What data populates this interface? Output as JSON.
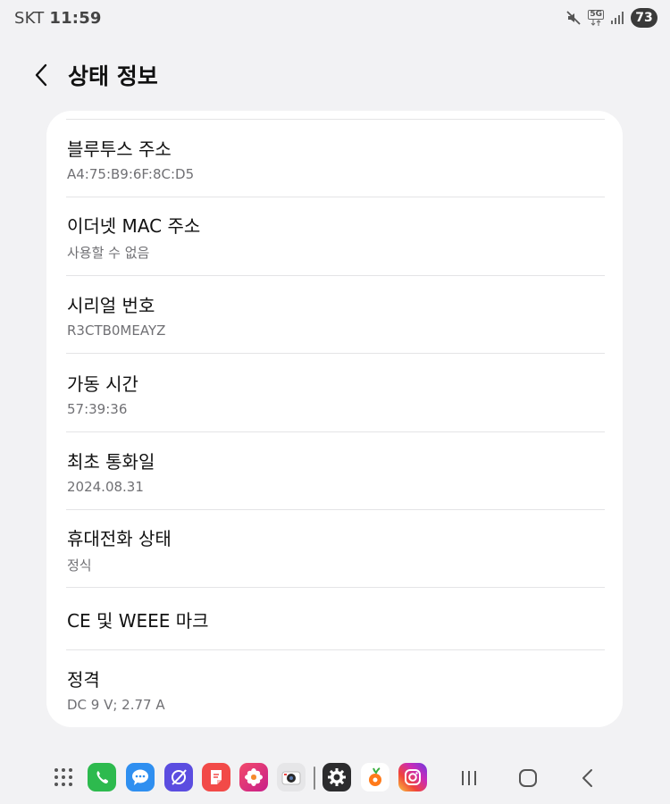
{
  "status_bar": {
    "carrier": "SKT",
    "time": "11:59",
    "network": "5G",
    "battery": "73",
    "icons": [
      "mute-icon",
      "network-5g-icon",
      "signal-icon"
    ]
  },
  "header": {
    "title": "상태 정보",
    "back_icon": "chevron-left-icon"
  },
  "items": [
    {
      "label": "블루투스 주소",
      "value": "A4:75:B9:6F:8C:D5"
    },
    {
      "label": "이더넷 MAC 주소",
      "value": "사용할 수 없음"
    },
    {
      "label": "시리얼 번호",
      "value": "R3CTB0MEAYZ"
    },
    {
      "label": "가동 시간",
      "value": "57:39:36"
    },
    {
      "label": "최초 통화일",
      "value": "2024.08.31"
    },
    {
      "label": "휴대전화 상태",
      "value": "정식"
    },
    {
      "label": "CE 및 WEEE 마크"
    },
    {
      "label": "정격",
      "value": "DC 9 V; 2.77 A"
    }
  ],
  "dock": {
    "apps": [
      "phone-icon",
      "messages-icon",
      "internet-icon",
      "notes-icon",
      "gallery-icon",
      "camera-icon",
      "settings-icon",
      "carrot-app-icon",
      "instagram-icon"
    ],
    "nav": [
      "recent-apps-icon",
      "home-icon",
      "back-icon"
    ],
    "colors": {
      "phone": "#2dba4e",
      "messages": "#2f8ff0",
      "internet": "#5b4de0",
      "notes": "#f24a48",
      "gallery": "#e8307a",
      "camera": "#e6e6e8",
      "settings": "#2c2c2e"
    }
  }
}
